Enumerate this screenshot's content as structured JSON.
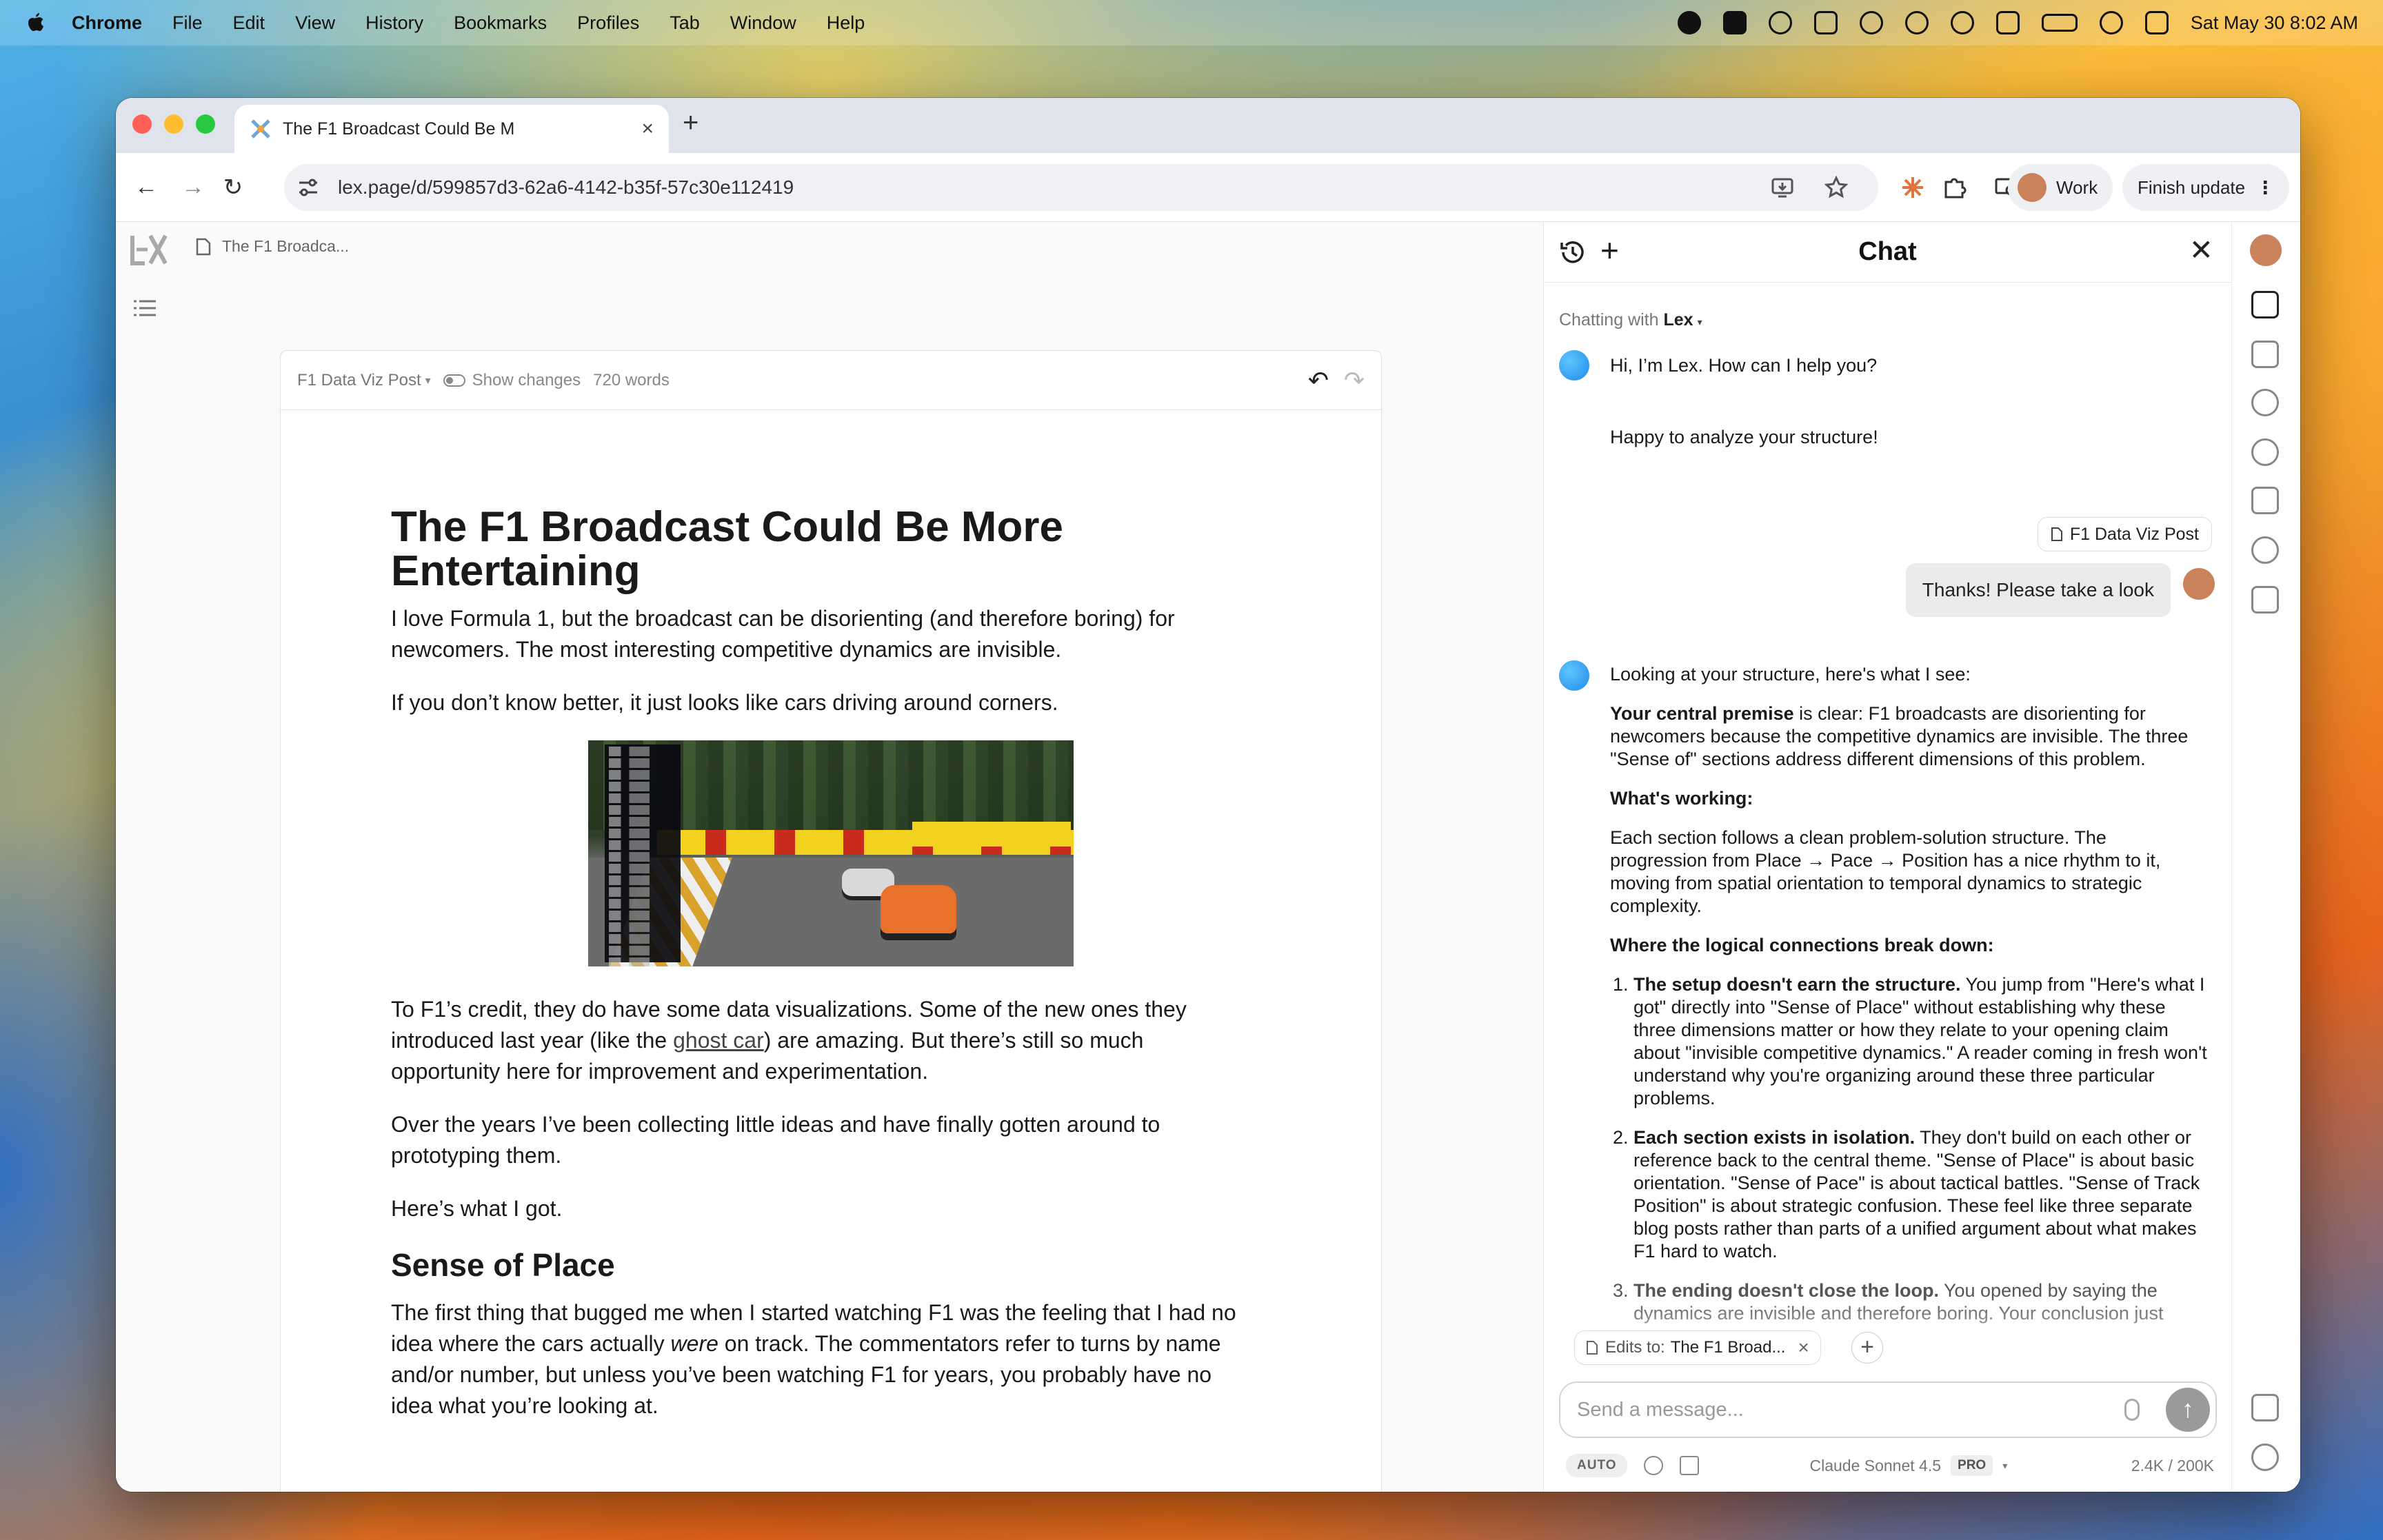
{
  "menubar": {
    "app": "Chrome",
    "items": [
      "File",
      "Edit",
      "View",
      "History",
      "Bookmarks",
      "Profiles",
      "Tab",
      "Window",
      "Help"
    ],
    "clock": "Sat May 30  8:02 AM"
  },
  "browser": {
    "tab_title": "The F1 Broadcast Could Be M",
    "url": "lex.page/d/599857d3-62a6-4142-b35f-57c30e112419",
    "profile_label": "Work",
    "update_label": "Finish update"
  },
  "lex": {
    "breadcrumb": "The F1 Broadca...",
    "doc_label": "F1 Data Viz Post",
    "show_changes": "Show changes",
    "word_count": "720 words",
    "article": {
      "title": "The F1 Broadcast Could Be More Entertaining",
      "p1": "I love Formula 1, but the broadcast can be disorienting (and therefore boring) for newcomers. The most interesting competitive dynamics are invisible.",
      "p2": "If you don’t know better, it just looks like cars driving around corners.",
      "p3_before": "To F1’s credit, they do have some data visualizations. Some of the new ones they introduced last year (like the ",
      "p3_link": "ghost car",
      "p3_after": ") are amazing. But there’s still so much opportunity here for improvement and experimentation.",
      "p4": "Over the years I’ve been collecting little ideas and have finally gotten around to prototyping them.",
      "p5": "Here’s what I got.",
      "h2": "Sense of Place",
      "p6_before": "The first thing that bugged me when I started watching F1 was the feeling that I had no idea where the cars actually ",
      "p6_em": "were",
      "p6_after": " on track. The commentators refer to turns by name and/or number, but unless you’ve been watching F1 for years, you probably have no idea what you’re looking at."
    }
  },
  "chat": {
    "title": "Chat",
    "chatting_with_prefix": "Chatting with",
    "assistant_name": "Lex",
    "greeting": "Hi, I’m Lex. How can I help you?",
    "reply1": "Happy to analyze your structure!",
    "attachment": "F1 Data Viz Post",
    "user_message": "Thanks! Please take a look",
    "analysis": {
      "intro": "Looking at your structure, here's what I see:",
      "premise_bold": "Your central premise",
      "premise_rest": " is clear: F1 broadcasts are disorienting for newcomers because the competitive dynamics are invisible. The three \"Sense of\" sections address different dimensions of this problem.",
      "working_heading": "What's working:",
      "working_text": "Each section follows a clean problem-solution structure. The progression from Place → Pace → Position has a nice rhythm to it, moving from spatial orientation to temporal dynamics to strategic complexity.",
      "break_heading": "Where the logical connections break down:",
      "point1_bold": "The setup doesn't earn the structure.",
      "point1_rest": " You jump from \"Here's what I got\" directly into \"Sense of Place\" without establishing why these three dimensions matter or how they relate to your opening claim about \"invisible competitive dynamics.\" A reader coming in fresh won't understand why you're organizing around these three particular problems.",
      "point2_bold": "Each section exists in isolation.",
      "point2_rest": " They don't build on each other or reference back to the central theme. \"Sense of Place\" is about basic orientation. \"Sense of Pace\" is about tactical battles. \"Sense of Track Position\" is about strategic confusion. These feel like three separate blog posts rather than parts of a unified argument about what makes F1 hard to watch.",
      "point3_bold": "The ending doesn't close the loop.",
      "point3_rest": " You opened by saying the dynamics are invisible and therefore boring. Your conclusion just"
    },
    "edits_prefix": "Edits to:",
    "edits_target": "The F1 Broad...",
    "composer_placeholder": "Send a message...",
    "auto_label": "AUTO",
    "model": "Claude Sonnet 4.5",
    "plan_badge": "PRO",
    "tokens": "2.4K / 200K"
  }
}
